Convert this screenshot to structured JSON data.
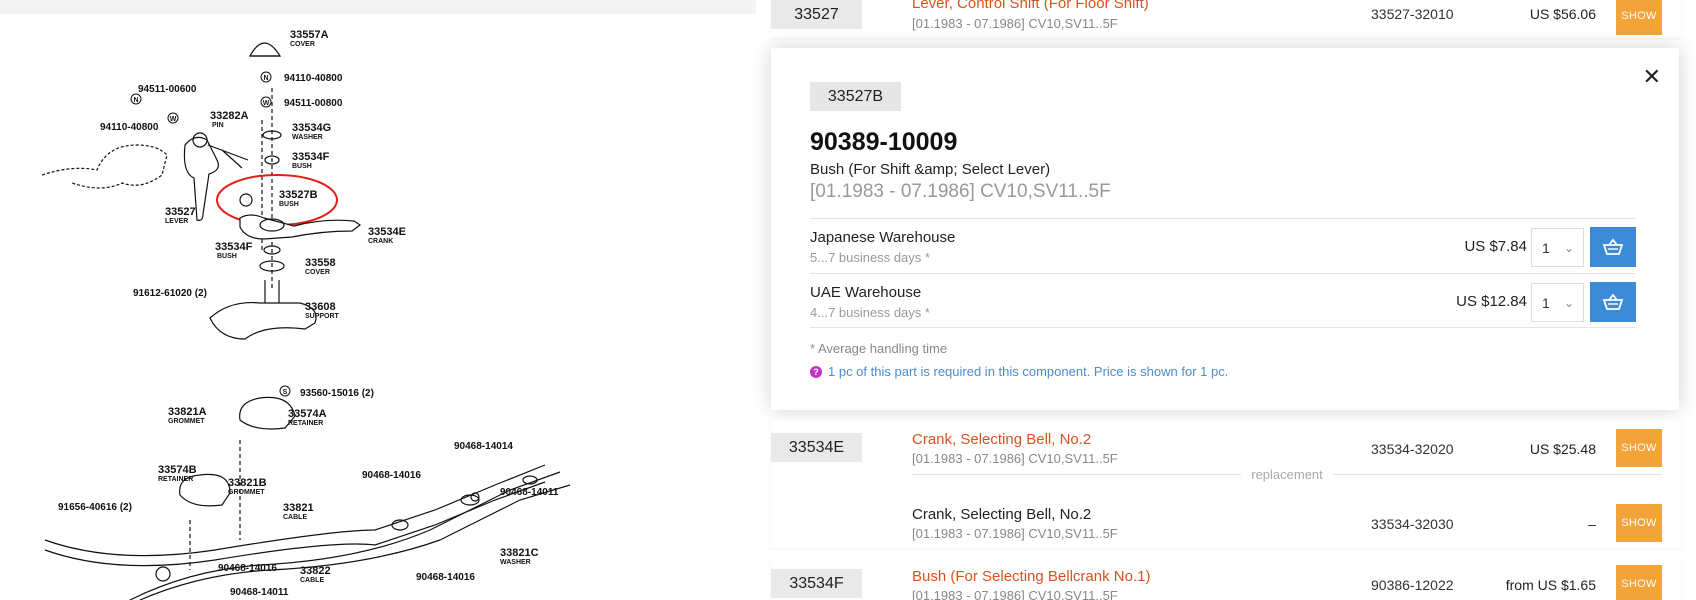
{
  "diagram": {
    "labels": [
      {
        "code": "33557A",
        "sub": "COVER"
      },
      {
        "code": "94110-40800",
        "sub": ""
      },
      {
        "code": "94511-00600",
        "sub": ""
      },
      {
        "code": "94511-00800",
        "sub": ""
      },
      {
        "code": "33282A",
        "sub": "PIN"
      },
      {
        "code": "94110-40800",
        "sub": ""
      },
      {
        "code": "33534G",
        "sub": "WASHER"
      },
      {
        "code": "33534F",
        "sub": "BUSH"
      },
      {
        "code": "33527B",
        "sub": "BUSH"
      },
      {
        "code": "33527",
        "sub": "LEVER"
      },
      {
        "code": "33534E",
        "sub": "CRANK"
      },
      {
        "code": "33534F",
        "sub": "BUSH"
      },
      {
        "code": "33558",
        "sub": "COVER"
      },
      {
        "code": "91612-61020 (2)",
        "sub": ""
      },
      {
        "code": "33608",
        "sub": "SUPPORT"
      },
      {
        "code": "93560-15016 (2)",
        "sub": ""
      },
      {
        "code": "33821A",
        "sub": "GROMMET"
      },
      {
        "code": "33574A",
        "sub": "RETAINER"
      },
      {
        "code": "90468-14014",
        "sub": ""
      },
      {
        "code": "33574B",
        "sub": "RETAINER"
      },
      {
        "code": "33821B",
        "sub": "GROMMET"
      },
      {
        "code": "90468-14016",
        "sub": ""
      },
      {
        "code": "90468-14011",
        "sub": ""
      },
      {
        "code": "91656-40616 (2)",
        "sub": ""
      },
      {
        "code": "33821",
        "sub": "CABLE"
      },
      {
        "code": "33821C",
        "sub": "WASHER"
      },
      {
        "code": "90468-14016",
        "sub": ""
      },
      {
        "code": "33822",
        "sub": "CABLE"
      },
      {
        "code": "90468-14016",
        "sub": ""
      },
      {
        "code": "90468-14011",
        "sub": ""
      }
    ],
    "markers": [
      "N",
      "W",
      "N",
      "W",
      "S"
    ]
  },
  "rows": {
    "r1": {
      "code": "33527",
      "name": "Lever, Control Shift (For Floor Shift)",
      "range": "[01.1983 - 07.1986] CV10,SV11..5F",
      "number": "33527-32010",
      "price": "US $56.06",
      "show": "SHOW"
    },
    "r2": {
      "code": "33534E",
      "name": "Crank, Selecting Bell, No.2",
      "range": "[01.1983 - 07.1986] CV10,SV11..5F",
      "number": "33534-32020",
      "price": "US $25.48",
      "show": "SHOW",
      "replacement_label": "replacement",
      "alt": {
        "name": "Crank, Selecting Bell, No.2",
        "range": "[01.1983 - 07.1986] CV10,SV11..5F",
        "number": "33534-32030",
        "price": "–",
        "show": "SHOW"
      }
    },
    "r3": {
      "code": "33534F",
      "name": "Bush (For Selecting Bellcrank No.1)",
      "range": "[01.1983 - 07.1986] CV10,SV11..5F",
      "number": "90386-12022",
      "price": "from US $1.65",
      "show": "SHOW"
    }
  },
  "detail": {
    "code": "33527B",
    "part_number": "90389-10009",
    "description": "Bush (For Shift &amp; Select Lever)",
    "range": "[01.1983 - 07.1986] CV10,SV11..5F",
    "close": "✕",
    "warehouses": [
      {
        "name": "Japanese Warehouse",
        "days": "5...7 business days *",
        "price": "US $7.84",
        "qty": "1"
      },
      {
        "name": "UAE Warehouse",
        "days": "4...7 business days *",
        "price": "US $12.84",
        "qty": "1"
      }
    ],
    "note": "* Average handling time",
    "info": "1 pc of this part is required in this component. Price is shown for 1 pc.",
    "info_icon": "?"
  },
  "colors": {
    "accent_orange": "#f2a339",
    "link_red": "#d9531e",
    "cart_blue": "#3d8bd6",
    "highlight_circle": "#e0201a"
  }
}
